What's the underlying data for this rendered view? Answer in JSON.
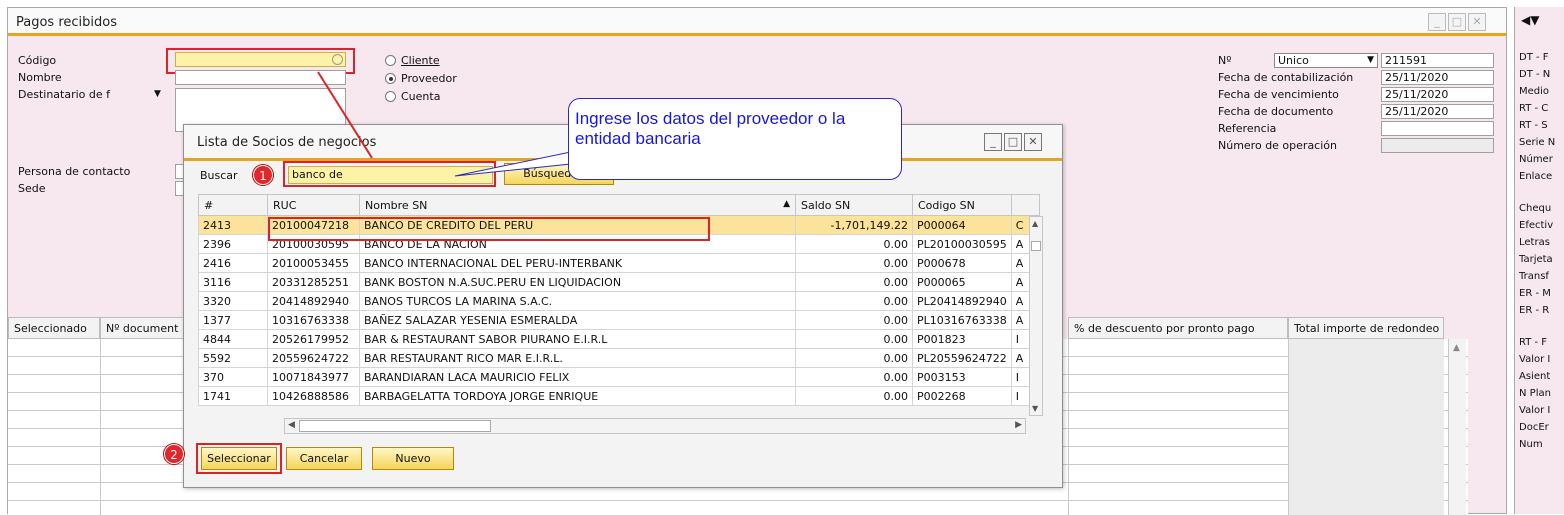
{
  "window": {
    "title": "Pagos recibidos"
  },
  "header_left": {
    "codigo_label": "Código",
    "nombre_label": "Nombre",
    "destinatario_label": "Destinatario de f",
    "contacto_label": "Persona de contacto",
    "sede_label": "Sede"
  },
  "radios": [
    {
      "label": "Cliente",
      "selected": false
    },
    {
      "label": "Proveedor",
      "selected": true
    },
    {
      "label": "Cuenta",
      "selected": false
    }
  ],
  "header_right": {
    "no_label": "Nº",
    "series": "Unico",
    "number": "211591",
    "fecha_contab_label": "Fecha de contabilización",
    "fecha_contab": "25/11/2020",
    "fecha_venc_label": "Fecha de vencimiento",
    "fecha_venc": "25/11/2020",
    "fecha_doc_label": "Fecha de documento",
    "fecha_doc": "25/11/2020",
    "referencia_label": "Referencia",
    "referencia": "",
    "operacion_label": "Número de operación",
    "operacion": ""
  },
  "grid": {
    "headers": [
      "Seleccionado",
      "Nº document",
      "% de descuento por pronto pago",
      "Total importe de redondeo"
    ]
  },
  "dialog": {
    "title": "Lista de Socios de negocios",
    "buscar_label": "Buscar",
    "search_value": "banco de",
    "busqueda_btn": "Búsqueda av",
    "columns": [
      "#",
      "RUC",
      "Nombre SN",
      "Saldo SN",
      "Codigo SN"
    ],
    "rows": [
      {
        "n": "2413",
        "ruc": "20100047218",
        "nombre": "BANCO DE CREDITO DEL PERU",
        "saldo": "-1,701,149.22",
        "codigo": "P000064",
        "x": "C"
      },
      {
        "n": "2396",
        "ruc": "20100030595",
        "nombre": "BANCO DE LA NACION",
        "saldo": "0.00",
        "codigo": "PL20100030595",
        "x": "A"
      },
      {
        "n": "2416",
        "ruc": "20100053455",
        "nombre": "BANCO INTERNACIONAL DEL PERU-INTERBANK",
        "saldo": "0.00",
        "codigo": "P000678",
        "x": "A"
      },
      {
        "n": "3116",
        "ruc": "20331285251",
        "nombre": "BANK BOSTON N.A.SUC.PERU EN LIQUIDACION",
        "saldo": "0.00",
        "codigo": "P000065",
        "x": "A"
      },
      {
        "n": "3320",
        "ruc": "20414892940",
        "nombre": "BANOS TURCOS LA MARINA S.A.C.",
        "saldo": "0.00",
        "codigo": "PL20414892940",
        "x": "A"
      },
      {
        "n": "1377",
        "ruc": "10316763338",
        "nombre": "BAÑEZ SALAZAR YESENIA ESMERALDA",
        "saldo": "0.00",
        "codigo": "PL10316763338",
        "x": "A"
      },
      {
        "n": "4844",
        "ruc": "20526179952",
        "nombre": "BAR & RESTAURANT SABOR  PIURANO E.I.R.L",
        "saldo": "0.00",
        "codigo": "P001823",
        "x": "I"
      },
      {
        "n": "5592",
        "ruc": "20559624722",
        "nombre": "BAR RESTAURANT RICO MAR E.I.R.L.",
        "saldo": "0.00",
        "codigo": "PL20559624722",
        "x": "A"
      },
      {
        "n": "370",
        "ruc": "10071843977",
        "nombre": "BARANDIARAN LACA MAURICIO FELIX",
        "saldo": "0.00",
        "codigo": "P003153",
        "x": "I"
      },
      {
        "n": "1741",
        "ruc": "10426888586",
        "nombre": "BARBAGELATTA TORDOYA JORGE ENRIQUE",
        "saldo": "0.00",
        "codigo": "P002268",
        "x": "I"
      }
    ],
    "btn_select": "Seleccionar",
    "btn_cancel": "Cancelar",
    "btn_new": "Nuevo"
  },
  "callout": {
    "text": "Ingrese los datos del proveedor o la entidad bancaria"
  },
  "badges": [
    "1",
    "2"
  ],
  "sidebar": [
    "DT - F",
    "DT - N",
    "Medio",
    "RT - C",
    "RT - S",
    "Serie N",
    "Númer",
    "Enlace",
    "Chequ",
    "Efectiv",
    "Letras",
    "Tarjeta",
    "Transf",
    "ER - M",
    "ER - R",
    "RT - F",
    "Valor I",
    "Asient",
    "N Plan",
    "Valor I",
    "DocEr",
    "Num"
  ],
  "colors": {
    "accent": "#e7a41f",
    "highlight": "#fbe39b",
    "form_bg": "#f7e8ef",
    "annotation_red": "#d9252a",
    "callout_blue": "#1717d8"
  }
}
